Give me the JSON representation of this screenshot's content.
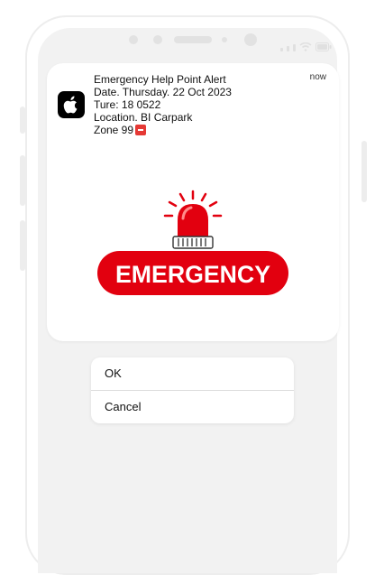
{
  "notification": {
    "app_icon": "apple-icon",
    "title": "Emergency Help Point Alert",
    "date": "Date. Thursday. 22 Oct 2023",
    "time": "Ture: 18 0522",
    "location": "Location. BI Carpark",
    "zone": "Zone 99",
    "zone_badge_icon": "red-box-icon",
    "timestamp": "now"
  },
  "emergency_graphic": {
    "label": "EMERGENCY",
    "icon": "siren-icon",
    "color": "#e2000f"
  },
  "actions": [
    {
      "label": "OK"
    },
    {
      "label": "Cancel"
    }
  ]
}
